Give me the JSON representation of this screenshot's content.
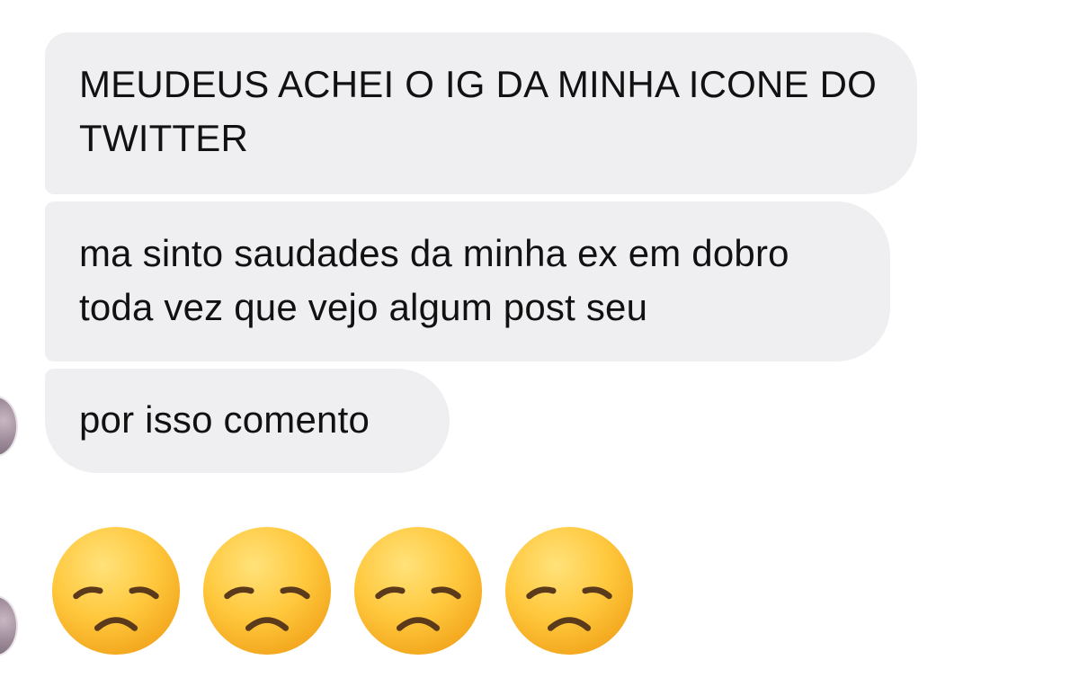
{
  "messages": [
    {
      "text": "MEUDEUS ACHEI O IG DA MINHA ICONE DO TWITTER"
    },
    {
      "text": "ma sinto saudades da minha ex em dobro toda vez que vejo algum post seu"
    },
    {
      "text": "por isso comento"
    }
  ],
  "emoji_message": {
    "icons": [
      "disappointed-face-icon",
      "disappointed-face-icon",
      "disappointed-face-icon",
      "disappointed-face-icon"
    ]
  },
  "colors": {
    "bubble": "#efeff2",
    "text": "#111111",
    "emoji_face": "#ffc83d"
  }
}
